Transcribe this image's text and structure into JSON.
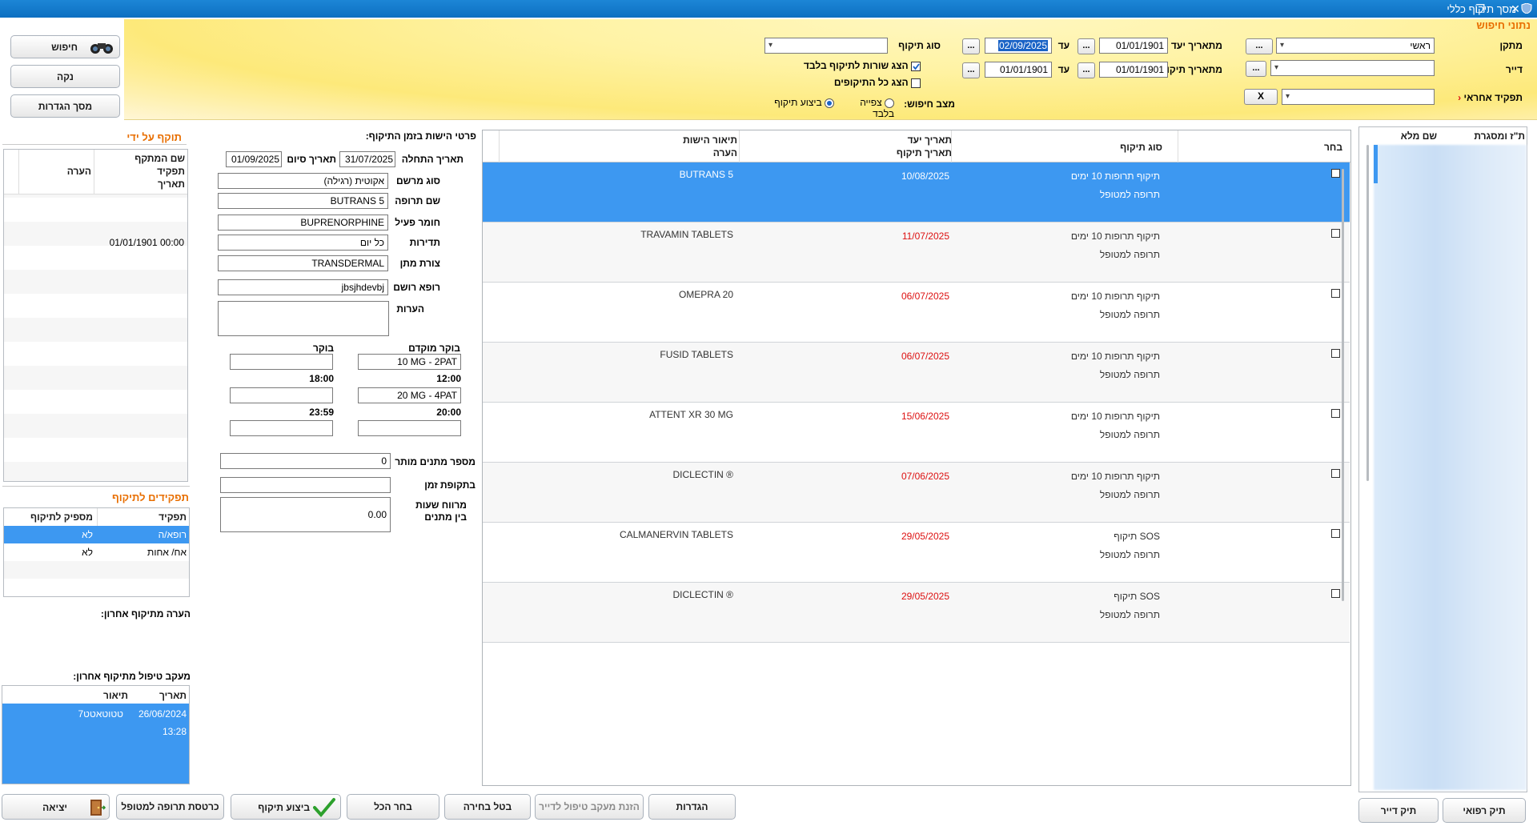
{
  "window": {
    "title": "מסך תיקוף כללי",
    "restore_glyph": "❐",
    "close_glyph": "✕",
    "icon": "shield-icon"
  },
  "left_buttons": {
    "search": "חיפוש",
    "clear": "נקה",
    "settings": "מסך הגדרות"
  },
  "search": {
    "section_title": "נתוני חיפוש",
    "facility_label": "מתקן",
    "facility_value": "ראשי",
    "resident_label": "דייר",
    "resident_value": "",
    "responsible_label": "תפקיד אחראי",
    "responsible_value": "",
    "clear_x": "X",
    "dots": "...",
    "due_from_label": "מתאריך יעד",
    "due_from": "01/01/1901",
    "to_label": "עד",
    "due_to": "02/09/2025",
    "valid_from_label": "מתאריך תיקוף",
    "valid_from": "01/01/1901",
    "valid_to": "01/01/1901",
    "type_label": "סוג תיקוף",
    "type_value": "",
    "only_rows_label": "הצג שורות לתיקוף בלבד",
    "show_all_label": "הצג כל התיקופים",
    "mode_label": "מצב חיפוש:",
    "mode_view": "צפייה בלבד",
    "mode_exec": "ביצוע תיקוף"
  },
  "validated_by": {
    "title": "תוקף על ידי",
    "col_name": "שם המתקף",
    "col_role": "תפקיד",
    "col_date": "תאריך",
    "col_note": "הערה",
    "row_date": "01/01/1901 00:00"
  },
  "roles": {
    "title": "תפקידים לתיקוף",
    "col_role": "תפקיד",
    "col_enough": "מספיק לתיקוף",
    "rows": [
      {
        "role": "רופא/ה",
        "enough": "לא"
      },
      {
        "role": "אח/ אחות",
        "enough": "לא"
      }
    ]
  },
  "last_note_label": "הערה מתיקוף אחרון:",
  "tracking": {
    "title": "מעקב טיפול מתיקוף אחרון:",
    "col_date": "תאריך",
    "col_desc": "תיאור",
    "date": "26/06/2024",
    "time": "13:28",
    "desc": "טטוטאטט7"
  },
  "details": {
    "title": "פרטי הישות בזמן התיקוף:",
    "start_label": "תאריך התחלה",
    "start": "31/07/2025",
    "end_label": "תאריך סיום",
    "end": "01/09/2025",
    "rx_type_label": "סוג מרשם",
    "rx_type": "אקוטית (רגילה)",
    "drug_label": "שם תרופה",
    "drug": "BUTRANS 5",
    "active_label": "חומר פעיל",
    "active": "BUPRENORPHINE",
    "freq_label": "תדירות",
    "freq": "כל יום",
    "form_label": "צורת מתן",
    "form": "TRANSDERMAL",
    "doctor_label": "רופא רושם",
    "doctor": "jbsjhdevbj",
    "notes_label": "הערות",
    "notes": "",
    "early_morning_label": "בוקר מוקדם",
    "morning_label": "בוקר",
    "dose1": "10 MG - 2PAT",
    "time1": "12:00",
    "time2": "18:00",
    "dose2": "20 MG - 4PAT",
    "time3": "20:00",
    "time4": "23:59",
    "allowed_count_label": "מספר מתנים מותר",
    "allowed_count": "0",
    "time_period_label": "בתקופת זמן",
    "time_period": "",
    "interval_label": "מרווח שעות בין מתנים",
    "interval": "0.00"
  },
  "grid": {
    "col_select": "בחר",
    "col_type": "סוג תיקוף",
    "col_due": "תאריך יעד",
    "col_valid": "תאריך תיקוף",
    "col_desc": "תיאור הישות",
    "col_note": "הערה",
    "rows": [
      {
        "type": "תיקוף תרופות 10 ימים",
        "sub": "תרופה למטופל",
        "date": "10/08/2025",
        "desc": "BUTRANS 5",
        "red": false
      },
      {
        "type": "תיקוף תרופות 10 ימים",
        "sub": "תרופה למטופל",
        "date": "11/07/2025",
        "desc": "TRAVAMIN TABLETS",
        "red": true
      },
      {
        "type": "תיקוף תרופות 10 ימים",
        "sub": "תרופה למטופל",
        "date": "06/07/2025",
        "desc": "OMEPRA 20",
        "red": true
      },
      {
        "type": "תיקוף תרופות 10 ימים",
        "sub": "תרופה למטופל",
        "date": "06/07/2025",
        "desc": "FUSID TABLETS",
        "red": true
      },
      {
        "type": "תיקוף תרופות 10 ימים",
        "sub": "תרופה למטופל",
        "date": "15/06/2025",
        "desc": "ATTENT XR 30 MG",
        "red": true
      },
      {
        "type": "תיקוף תרופות 10 ימים",
        "sub": "תרופה למטופל",
        "date": "07/06/2025",
        "desc": "DICLECTIN ®",
        "red": true
      },
      {
        "type": "SOS תיקוף",
        "sub": "תרופה למטופל",
        "date": "29/05/2025",
        "desc": "CALMANERVIN TABLETS",
        "red": true
      },
      {
        "type": "SOS תיקוף",
        "sub": "תרופה למטופל",
        "date": "29/05/2025",
        "desc": "DICLECTIN ®",
        "red": true
      }
    ]
  },
  "residents": {
    "col_id": "ת\"ז ומסגרת",
    "col_name": "שם מלא"
  },
  "bottom": {
    "exit": "יציאה",
    "med_card": "כרטסת תרופה למטופל",
    "execute": "ביצוע תיקוף",
    "select_all": "בחר הכל",
    "cancel_sel": "בטל בחירה",
    "tracking_entry": "הזנת מעקב טיפול לדייר",
    "settings": "הגדרות",
    "resident_file": "תיק דייר",
    "medical_file": "תיק רפואי"
  }
}
